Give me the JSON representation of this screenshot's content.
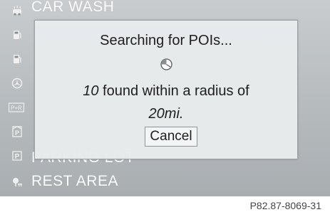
{
  "poi_list": {
    "items": [
      {
        "label": "CAR WASH",
        "icon": "car-wash-icon"
      },
      {
        "label": "",
        "icon": "gas-station-icon"
      },
      {
        "label": "",
        "icon": "gas-station-icon"
      },
      {
        "label": "",
        "icon": "dealer-icon"
      },
      {
        "label": "",
        "icon": "park-and-ride-icon"
      },
      {
        "label": "",
        "icon": "parking-garage-icon"
      },
      {
        "label": "PARKING LOT",
        "icon": "parking-lot-icon"
      },
      {
        "label": "REST AREA",
        "icon": "rest-area-icon"
      }
    ]
  },
  "dialog": {
    "title": "Searching for POIs...",
    "count": "10",
    "found_text": " found within a radius of",
    "radius": "20mi.",
    "cancel_label": "Cancel"
  },
  "figure_code": "P82.87-8069-31"
}
